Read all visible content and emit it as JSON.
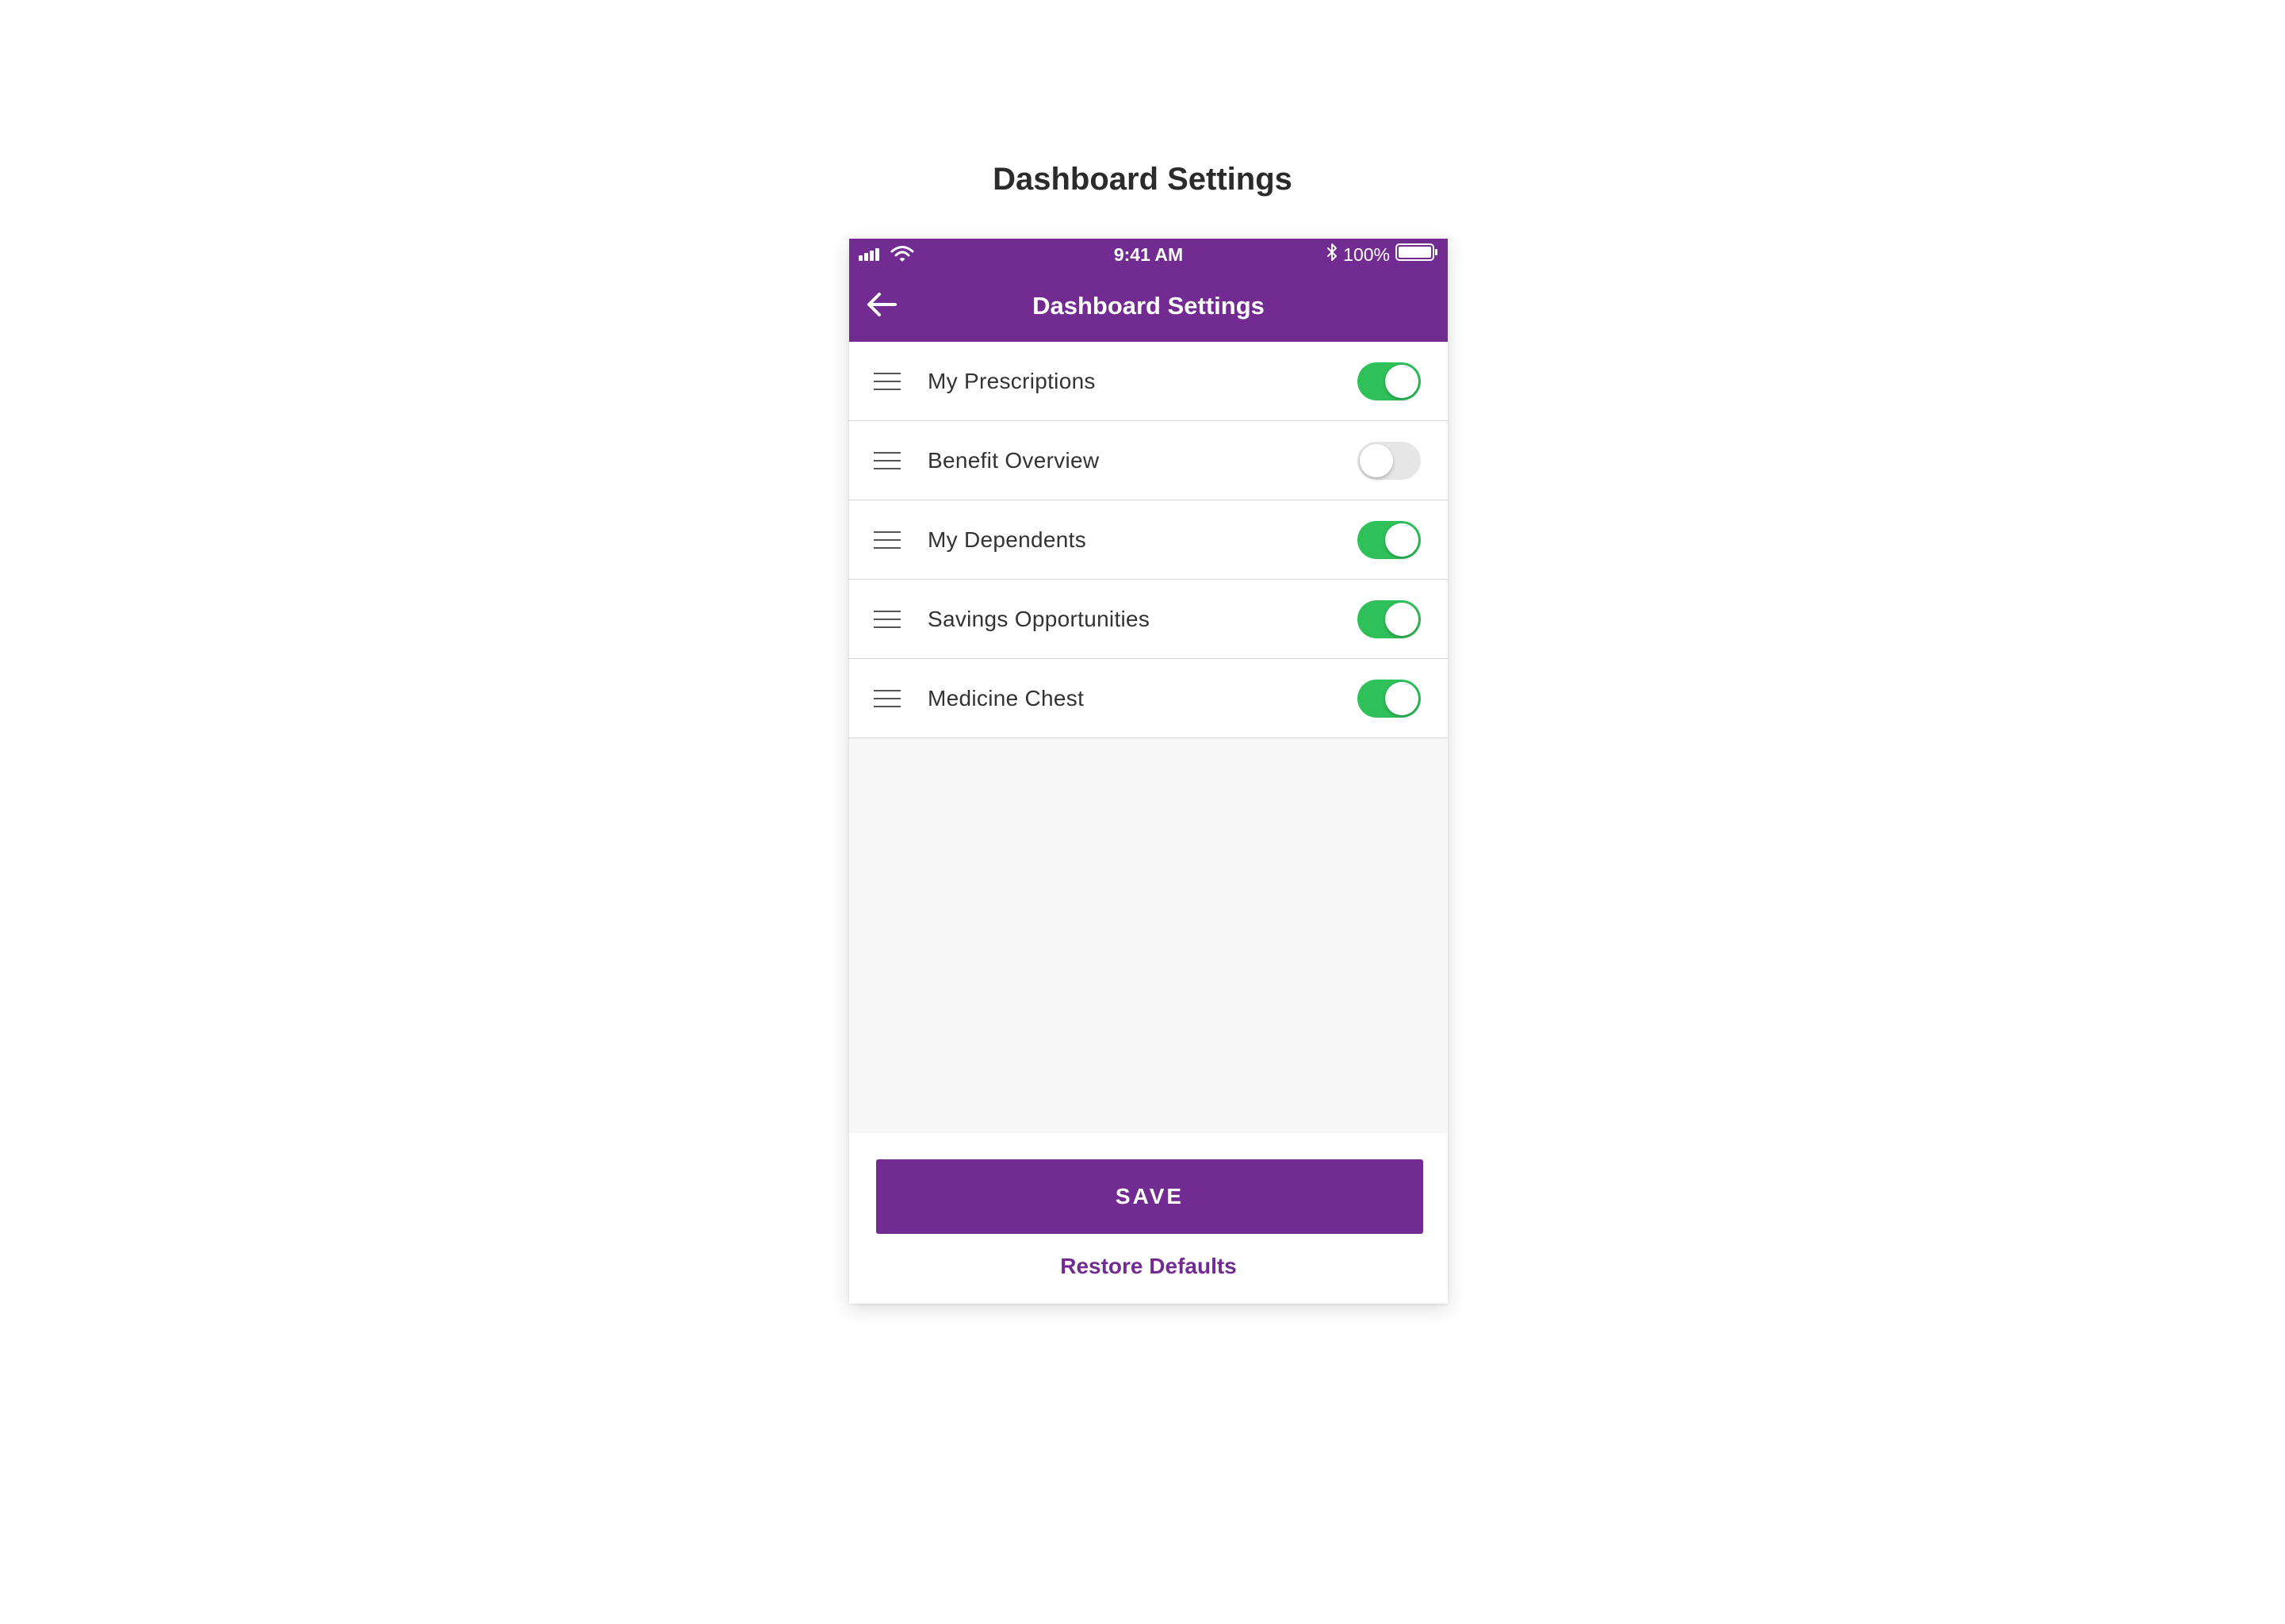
{
  "page": {
    "title": "Dashboard Settings"
  },
  "statusbar": {
    "time": "9:41 AM",
    "battery": "100%",
    "icons": [
      "signal-icon",
      "wifi-icon",
      "bluetooth-icon",
      "battery-icon"
    ]
  },
  "appbar": {
    "title": "Dashboard Settings",
    "back_icon": "back-arrow-icon"
  },
  "settings": {
    "items": [
      {
        "label": "My Prescriptions",
        "enabled": true
      },
      {
        "label": "Benefit Overview",
        "enabled": false
      },
      {
        "label": "My Dependents",
        "enabled": true
      },
      {
        "label": "Savings Opportunities",
        "enabled": true
      },
      {
        "label": "Medicine Chest",
        "enabled": true
      }
    ]
  },
  "actions": {
    "save_label": "SAVE",
    "restore_label": "Restore Defaults"
  },
  "colors": {
    "brand": "#722c91",
    "toggle_on": "#2fc05a",
    "toggle_off": "#e6e6e6"
  }
}
